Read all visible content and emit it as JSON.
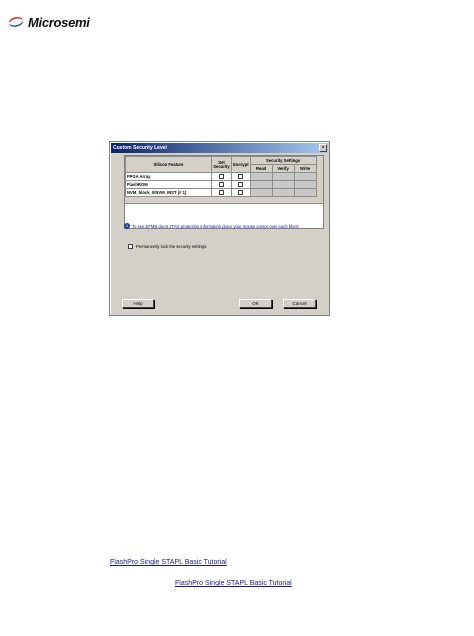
{
  "header": {
    "logo_text": "Microsemi",
    "logo_icon": "microsemi-swirl-icon",
    "brand_colors": {
      "swirl_red": "#d2232a",
      "swirl_blue": "#1d4f91"
    }
  },
  "dialog": {
    "title": "Custom Security Level",
    "close_label": "×",
    "columns": {
      "silicon_feature": "Silicon Feature",
      "set_security": "Set Security",
      "encrypt": "Encrypt",
      "security_settings": "Security Settings",
      "read": "Read",
      "verify": "Verify",
      "write": "Write"
    },
    "rows": [
      {
        "feature": "FPGA Array"
      },
      {
        "feature": "FlashROM"
      },
      {
        "feature": "NVM_block_0/NVM_INST (# 1)"
      }
    ],
    "info_text": "To see EFMB client JTAG protection information place your mouse cursor over each block",
    "lock_label": "Permanently lock the security settings.",
    "buttons": {
      "help": "Help",
      "ok": "OK",
      "cancel": "Cancel"
    }
  },
  "links": {
    "tutorial_1": "FlashPro Single STAPL Basic Tutorial",
    "tutorial_2": "FlashPro Single STAPL Basic Tutorial"
  }
}
